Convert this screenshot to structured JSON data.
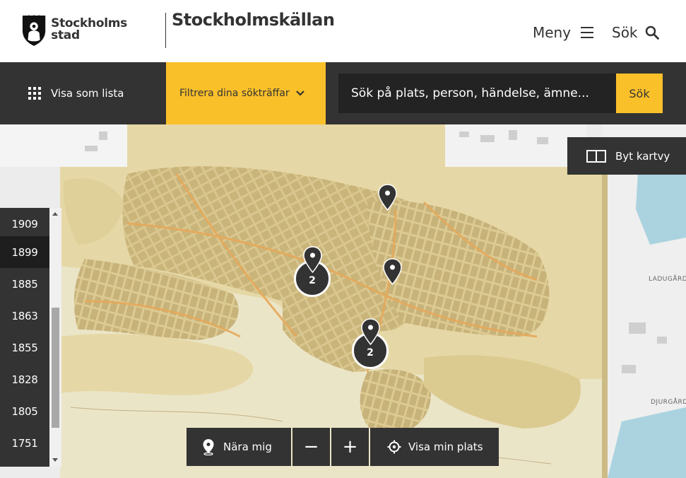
{
  "header": {
    "logo_line1": "Stockholms",
    "logo_line2": "stad",
    "site_title": "Stockholmskällan",
    "menu_label": "Meny",
    "search_label": "Sök"
  },
  "toolbar": {
    "list_label": "Visa som lista",
    "filter_label": "Filtrera dina sökträffar",
    "search_placeholder": "Sök på plats, person, händelse, ämne...",
    "search_button": "Sök"
  },
  "map": {
    "switch_map_label": "Byt kartvy",
    "years": [
      "1909",
      "1899",
      "1885",
      "1863",
      "1855",
      "1828",
      "1805",
      "1751"
    ],
    "active_year": "1899",
    "clusters": [
      {
        "count": "2"
      },
      {
        "count": "2"
      }
    ],
    "labels": {
      "ladugard": "LADUGÅRD",
      "djurgard": "DJURGÅRD"
    },
    "near_me_label": "Nära mig",
    "zoom_out_label": "−",
    "zoom_in_label": "+",
    "show_location_label": "Visa min plats"
  },
  "colors": {
    "dark": "#333333",
    "accent": "#fac02a",
    "map_old": "#e9dcb0"
  }
}
